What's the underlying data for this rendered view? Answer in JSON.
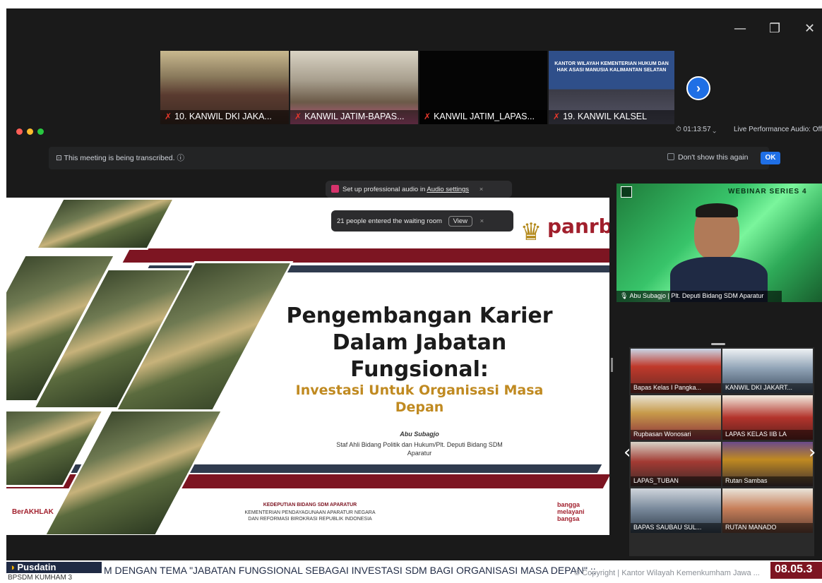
{
  "window_controls": {
    "minimize": "—",
    "restore": "❐",
    "close": "✕"
  },
  "strip": {
    "tiles": [
      {
        "label": "10. KANWIL DKI JAKA..."
      },
      {
        "label": "KANWIL JATIM-BAPAS..."
      },
      {
        "label": "KANWIL JATIM_LAPAS..."
      },
      {
        "label": "19. KANWIL KALSEL"
      }
    ],
    "kalsel_sign": "KANTOR WILAYAH KEMENTERIAN HUKUM DAN HAK ASASI MANUSIA KALIMANTAN SELATAN",
    "next": "›"
  },
  "meeting": {
    "timer": "01:13:57",
    "audio_mode": "Live Performance Audio: Off",
    "transcribe_banner": "This meeting is being transcribed.",
    "dont_show": "Don't show this again",
    "ok": "OK",
    "audio_popup": "Set up professional audio in",
    "audio_link": "Audio settings",
    "waiting_popup": "21 people entered the waiting room",
    "view": "View"
  },
  "slide": {
    "title_lines": [
      "Pengembangan Karier",
      "Dalam Jabatan",
      "Fungsional:"
    ],
    "subtitle_lines": [
      "Investasi Untuk Organisasi Masa",
      "Depan"
    ],
    "speaker_name": "Abu Subagjo",
    "speaker_role_1": "Staf Ahli Bidang Politik dan Hukum/Plt. Deputi Bidang SDM",
    "speaker_role_2": "Aparatur",
    "brand": "panrb",
    "footer_org_1": "KEDEPUTIAN BIDANG SDM APARATUR",
    "footer_org_2": "KEMENTERIAN PENDAYAGUNAAN APARATUR NEGARA",
    "footer_org_3": "DAN REFORMASI BIROKRASI REPUBLIK INDONESIA",
    "berakhlak": "BerAKHLAK",
    "bangga": "bangga melayani bangsa"
  },
  "speaker": {
    "label": "Abu Subagjo | Plt. Deputi Bidang SDM Aparatur",
    "webinar": "WEBINAR SERIES 4"
  },
  "grid": [
    {
      "label": "Bapas Kelas I Pangka..."
    },
    {
      "label": "KANWIL DKI JAKART..."
    },
    {
      "label": "Rupbasan Wonosari"
    },
    {
      "label": "LAPAS KELAS IIB LA"
    },
    {
      "label": "LAPAS_TUBAN"
    },
    {
      "label": "Rutan Sambas"
    },
    {
      "label": "BAPAS SAUBAU SUL..."
    },
    {
      "label": "RUTAN MANADO"
    }
  ],
  "ticker": {
    "pusdatin": "Pusdatin",
    "channel": "BPSDM KUMHAM 3",
    "text": "M DENGAN TEMA \"JABATAN FUNGSIONAL SEBAGAI INVESTASI SDM BAGI ORGANISASI MASA DEPAN\" ::",
    "copyright": "© Copyright | Kantor Wilayah Kemenkumham Jawa ...",
    "clock": "08.05.3"
  },
  "colors": {
    "maroon": "#7d1522",
    "gold": "#c08a21",
    "zoom_blue": "#1f6fe5"
  }
}
